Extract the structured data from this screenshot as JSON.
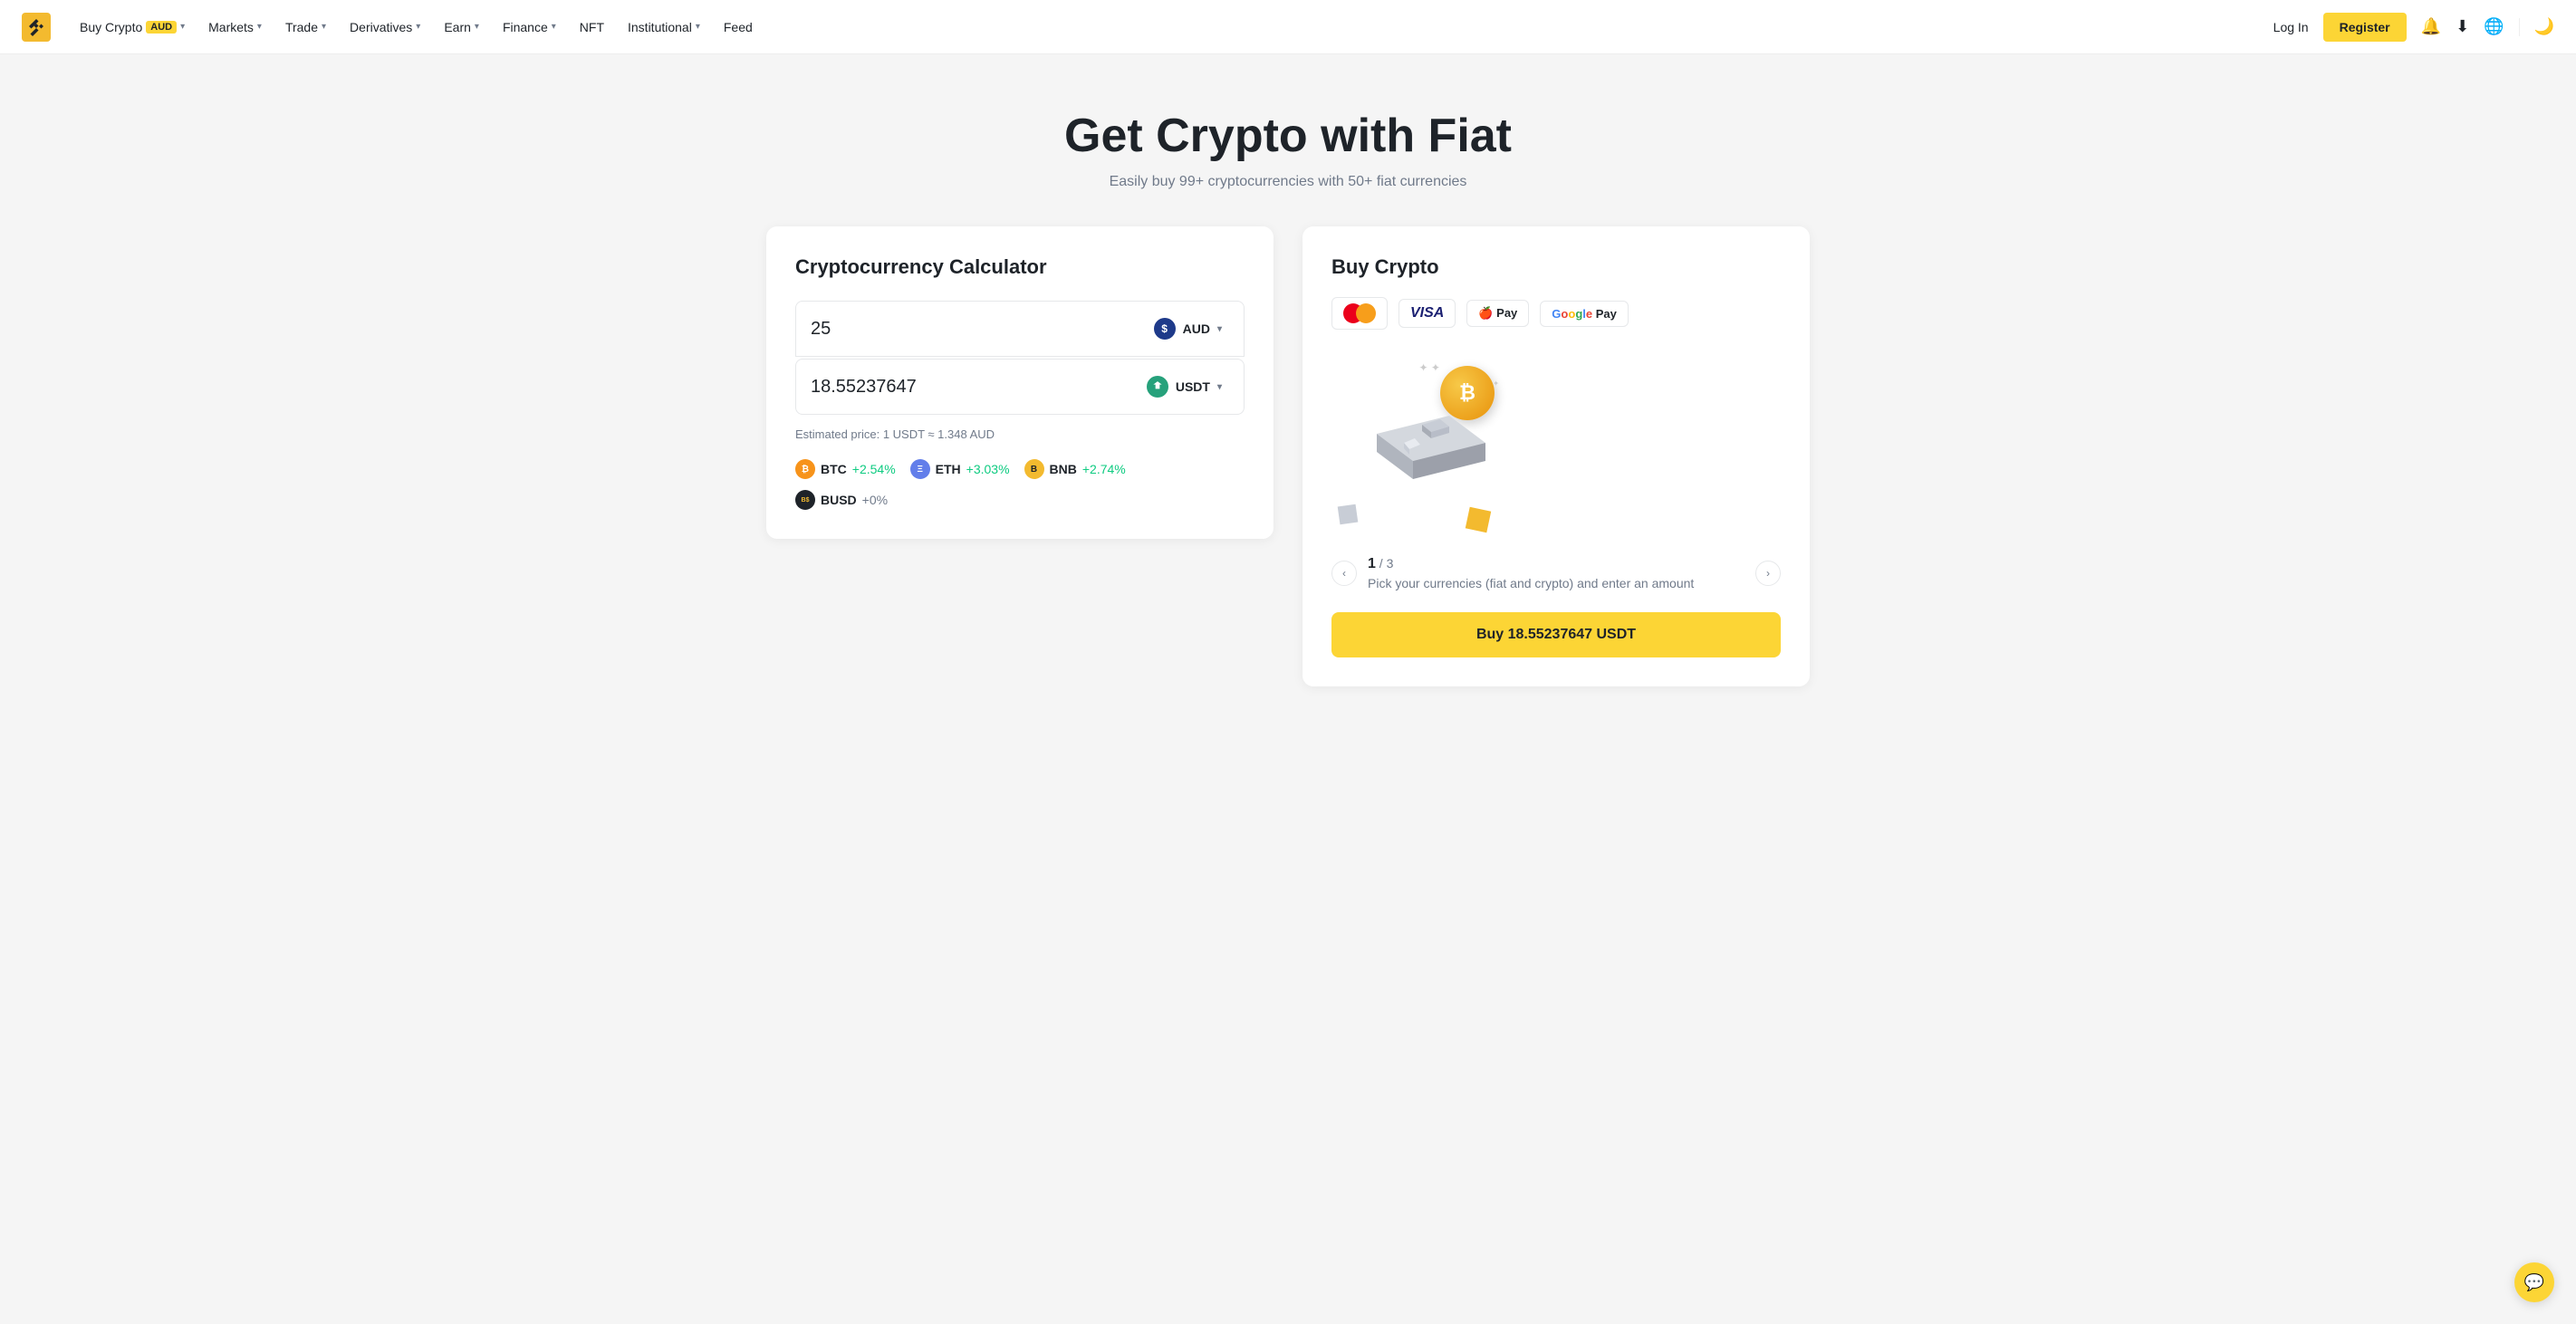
{
  "navbar": {
    "logo_text": "Binance",
    "items": [
      {
        "label": "Buy Crypto",
        "badge": "AUD",
        "has_dropdown": true
      },
      {
        "label": "Markets",
        "has_dropdown": true
      },
      {
        "label": "Trade",
        "has_dropdown": true
      },
      {
        "label": "Derivatives",
        "has_dropdown": true
      },
      {
        "label": "Earn",
        "has_dropdown": true
      },
      {
        "label": "Finance",
        "has_dropdown": true
      },
      {
        "label": "NFT",
        "has_dropdown": false
      },
      {
        "label": "Institutional",
        "has_dropdown": true
      },
      {
        "label": "Feed",
        "has_dropdown": false
      }
    ],
    "login_label": "Log In",
    "register_label": "Register"
  },
  "hero": {
    "title": "Get Crypto with Fiat",
    "subtitle": "Easily buy 99+ cryptocurrencies with 50+ fiat currencies"
  },
  "calculator": {
    "title": "Cryptocurrency Calculator",
    "fiat_value": "25",
    "fiat_currency": "AUD",
    "crypto_value": "18.55237647",
    "crypto_currency": "USDT",
    "estimated": "Estimated price: 1 USDT ≈ 1.348 AUD",
    "coins": [
      {
        "name": "BTC",
        "change": "+2.54%",
        "positive": true
      },
      {
        "name": "ETH",
        "change": "+3.03%",
        "positive": true
      },
      {
        "name": "BNB",
        "change": "+2.74%",
        "positive": true
      },
      {
        "name": "BUSD",
        "change": "+0%",
        "positive": false
      }
    ]
  },
  "buy_crypto": {
    "title": "Buy Crypto",
    "payment_methods": [
      "Mastercard",
      "Visa",
      "Apple Pay",
      "Google Pay"
    ],
    "step_current": "1",
    "step_total": "3",
    "step_description": "Pick your currencies (fiat and crypto) and enter an amount",
    "buy_button": "Buy 18.55237647 USDT"
  },
  "chat": {
    "icon": "💬"
  }
}
